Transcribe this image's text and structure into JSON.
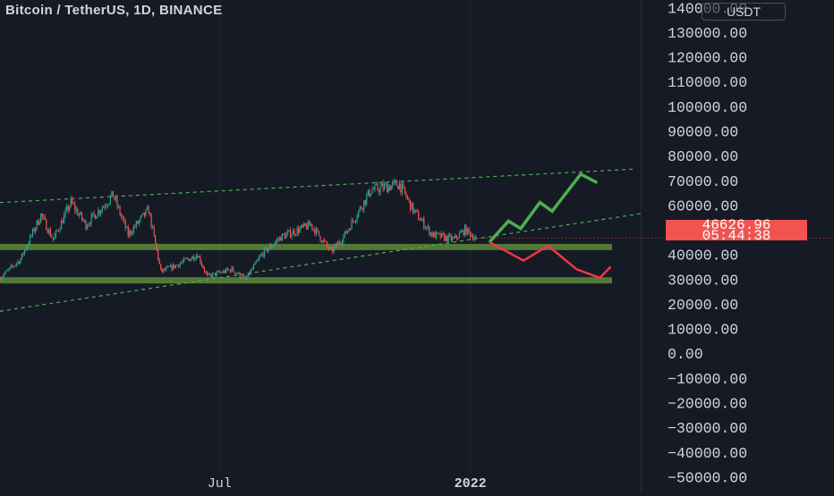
{
  "header": {
    "title": "Bitcoin / TetherUS, 1D, BINANCE",
    "currency": "USDT"
  },
  "last_price": {
    "value": "46626.96",
    "countdown": "05:44:38",
    "color": "#f05350"
  },
  "colors": {
    "background": "#161a25",
    "up_candle": "#26a69a",
    "down_candle": "#ef5350",
    "zone": "#5d8a3a",
    "trendline": "#4caf50",
    "bull_path": "#4caf50",
    "bear_path": "#f23645",
    "axis_text": "#d1d4dc",
    "grid": "#242834"
  },
  "chart_data": {
    "type": "candlestick",
    "title": "Bitcoin / TetherUS, 1D, BINANCE",
    "symbol": "BTCUSDT",
    "interval": "1D",
    "exchange": "BINANCE",
    "currency": "USDT",
    "x_range": [
      "2021-01-21",
      "2022-05-06"
    ],
    "ylim": [
      -56000,
      143000
    ],
    "y_ticks": [
      -50000,
      -40000,
      -30000,
      -20000,
      -10000,
      0,
      10000,
      20000,
      30000,
      40000,
      50000,
      60000,
      70000,
      80000,
      90000,
      100000,
      110000,
      120000,
      130000,
      140000
    ],
    "y_tick_labels": [
      "−50000.00",
      "−40000.00",
      "−30000.00",
      "−20000.00",
      "−10000.00",
      "0.00",
      "10000.00",
      "20000.00",
      "30000.00",
      "40000.00",
      "50000.00",
      "60000.00",
      "70000.00",
      "80000.00",
      "90000.00",
      "100000.00",
      "110000.00",
      "120000.00",
      "130000.00",
      "140000.00"
    ],
    "x_ticks": [
      {
        "date": "2021-07-01",
        "label": "Jul"
      },
      {
        "date": "2022-01-01",
        "label": "2022"
      }
    ],
    "grid": true,
    "price_path": [
      {
        "date": "2021-01-21",
        "price": 30500
      },
      {
        "date": "2021-02-05",
        "price": 38000
      },
      {
        "date": "2021-02-20",
        "price": 56000
      },
      {
        "date": "2021-03-01",
        "price": 46000
      },
      {
        "date": "2021-03-14",
        "price": 61000
      },
      {
        "date": "2021-03-25",
        "price": 52000
      },
      {
        "date": "2021-04-14",
        "price": 64000
      },
      {
        "date": "2021-04-25",
        "price": 48000
      },
      {
        "date": "2021-05-10",
        "price": 58000
      },
      {
        "date": "2021-05-19",
        "price": 33000
      },
      {
        "date": "2021-05-28",
        "price": 35000
      },
      {
        "date": "2021-06-15",
        "price": 40000
      },
      {
        "date": "2021-06-22",
        "price": 31000
      },
      {
        "date": "2021-07-10",
        "price": 34000
      },
      {
        "date": "2021-07-20",
        "price": 29800
      },
      {
        "date": "2021-08-01",
        "price": 40000
      },
      {
        "date": "2021-08-15",
        "price": 47000
      },
      {
        "date": "2021-09-06",
        "price": 52000
      },
      {
        "date": "2021-09-21",
        "price": 41000
      },
      {
        "date": "2021-10-01",
        "price": 48000
      },
      {
        "date": "2021-10-20",
        "price": 66000
      },
      {
        "date": "2021-11-10",
        "price": 68500
      },
      {
        "date": "2021-11-20",
        "price": 58000
      },
      {
        "date": "2021-12-04",
        "price": 48000
      },
      {
        "date": "2021-12-20",
        "price": 46000
      },
      {
        "date": "2021-12-28",
        "price": 50000
      },
      {
        "date": "2022-01-05",
        "price": 46626.96
      }
    ],
    "support_zones": [
      {
        "price": 43000,
        "from": "2021-01-21",
        "to": "2022-04-15"
      },
      {
        "price": 29500,
        "from": "2021-01-21",
        "to": "2022-04-15"
      }
    ],
    "trendlines": [
      {
        "style": "dashed",
        "points": [
          {
            "date": "2021-01-21",
            "price": 61000
          },
          {
            "date": "2022-04-30",
            "price": 74500
          }
        ]
      },
      {
        "style": "dashed",
        "points": [
          {
            "date": "2021-01-21",
            "price": 17000
          },
          {
            "date": "2022-05-06",
            "price": 56500
          }
        ]
      }
    ],
    "projections": [
      {
        "name": "",
        "direction": "up",
        "points": [
          {
            "date": "2022-01-15",
            "price": 45000
          },
          {
            "date": "2022-01-29",
            "price": 53500
          },
          {
            "date": "2022-02-07",
            "price": 50500
          },
          {
            "date": "2022-02-21",
            "price": 61000
          },
          {
            "date": "2022-03-02",
            "price": 57500
          },
          {
            "date": "2022-03-23",
            "price": 72500
          },
          {
            "date": "2022-04-04",
            "price": 69000
          }
        ]
      },
      {
        "name": "",
        "direction": "down",
        "points": [
          {
            "date": "2022-01-15",
            "price": 45000
          },
          {
            "date": "2022-02-09",
            "price": 37500
          },
          {
            "date": "2022-02-27",
            "price": 43500
          },
          {
            "date": "2022-03-20",
            "price": 34000
          },
          {
            "date": "2022-04-06",
            "price": 30500
          },
          {
            "date": "2022-04-14",
            "price": 35000
          }
        ]
      }
    ]
  }
}
